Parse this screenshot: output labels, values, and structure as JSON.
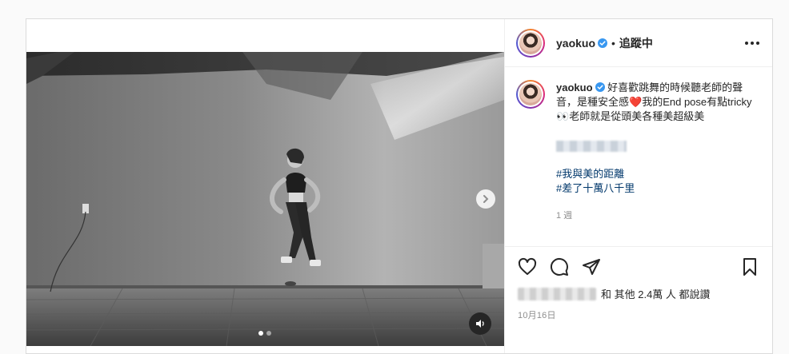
{
  "post": {
    "username": "yaokuo",
    "follow_status": "追蹤中",
    "separator": "•",
    "caption_username": "yaokuo",
    "caption_text_1": "好喜歡跳舞的時候聽老師的聲音，是種安全感",
    "caption_emoji_heart": "❤️",
    "caption_text_2": "我的End pose有點tricky",
    "caption_emoji_eyes": "👀",
    "caption_text_3": "老師就是從頭美各種美超級美",
    "caption_text_4": "",
    "hashtags": [
      "#我與美的距離",
      "#差了十萬八千里"
    ],
    "time_ago": "1 週",
    "likes_text": "和 其他 2.4萬 人 都說讚",
    "date": "10月16日"
  },
  "colors": {
    "verified": "#3897f0",
    "hashtag": "#00376b",
    "muted": "#8e8e8e"
  },
  "icons": {
    "like": "heart-icon",
    "comment": "comment-icon",
    "share": "paper-plane-icon",
    "save": "bookmark-icon",
    "more": "more-icon",
    "next": "chevron-right-icon",
    "sound": "speaker-icon"
  },
  "carousel": {
    "current": 1,
    "total": 2
  }
}
